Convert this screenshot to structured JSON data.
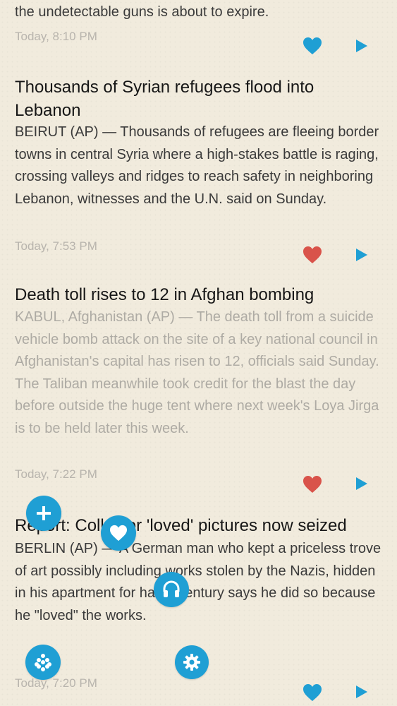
{
  "articles": [
    {
      "title": "",
      "body": "the undetectable guns is about to expire.",
      "time": "Today, 8:10 PM",
      "liked": false,
      "read": false
    },
    {
      "title": "Thousands of Syrian refugees flood into Lebanon",
      "body": "BEIRUT (AP) — Thousands of refugees are fleeing border towns in central Syria where a high-stakes battle is raging, crossing valleys and ridges to reach safety in neighboring Lebanon, witnesses and the U.N. said on Sunday.",
      "time": "Today, 7:53 PM",
      "liked": true,
      "read": false
    },
    {
      "title": "Death toll rises to 12 in Afghan bombing",
      "body": "KABUL, Afghanistan (AP) — The death toll from a suicide vehicle bomb attack on the site of a key national council in Afghanistan's capital has risen to 12, officials said Sunday. The Taliban meanwhile took credit for the blast the day before outside the huge tent where next week's Loya Jirga is to be held later this week.",
      "time": "Today, 7:22 PM",
      "liked": true,
      "read": true
    },
    {
      "title": "Report: Collector 'loved' pictures now seized",
      "body": "BERLIN (AP) — A German man who kept a priceless trove of art possibly including works stolen by the Nazis, hidden in his apartment for half a century says he did so because he \"loved\" the works.",
      "time": "Today, 7:20 PM",
      "liked": false,
      "read": false
    }
  ],
  "icons": {
    "add": "plus-icon",
    "favorite": "heart-icon",
    "listen": "headphones-icon",
    "menu": "grid-dots-icon",
    "settings": "gear-icon",
    "play": "play-icon"
  },
  "colors": {
    "accent": "#1f9fd4",
    "liked": "#d9534a",
    "background": "#f1ebdd"
  }
}
